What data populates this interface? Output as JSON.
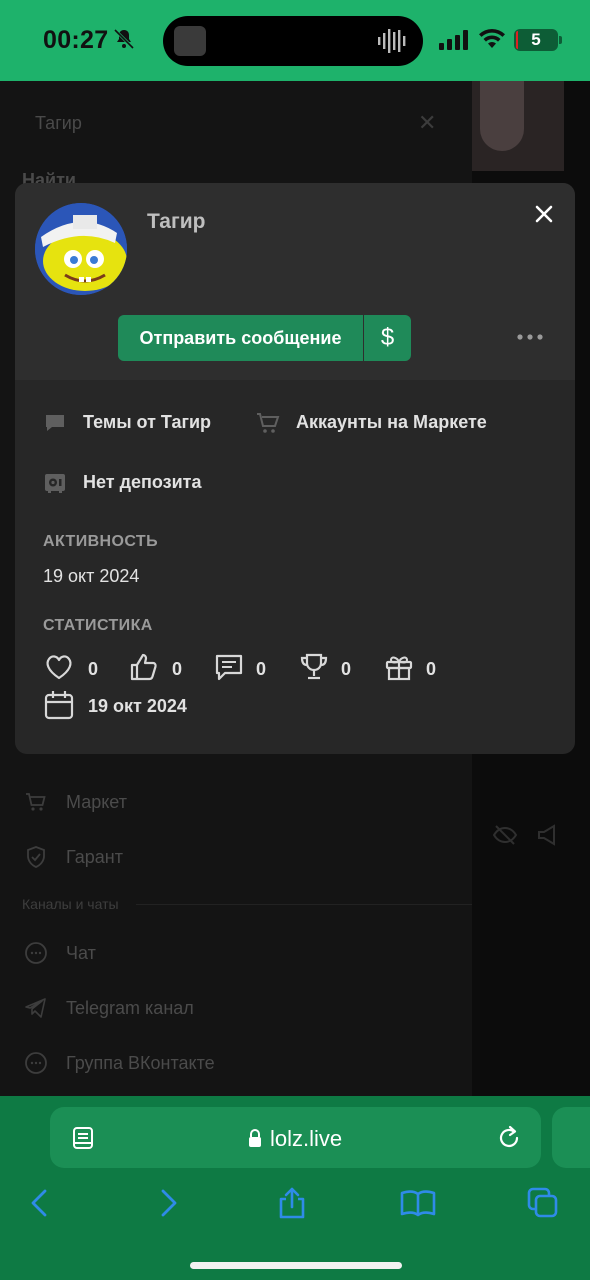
{
  "status_bar": {
    "time": "00:27",
    "battery": "5",
    "battery_level_percent": 5
  },
  "background_page": {
    "search_value": "Тагир",
    "find_label": "Найти",
    "items": [
      "Маркет",
      "Гарант"
    ],
    "section_label": "Каналы и чаты",
    "channels": [
      "Чат",
      "Telegram канал",
      "Группа ВКонтакте"
    ]
  },
  "profile_card": {
    "username": "Тагир",
    "send_message_label": "Отправить сообщение",
    "money_label": "$",
    "topics_label": "Темы от Тагир",
    "market_accounts_label": "Аккаунты на Маркете",
    "deposit_label": "Нет депозита",
    "activity_title": "АКТИВНОСТЬ",
    "activity_date": "19 окт 2024",
    "stats_title": "СТАТИСТИКА",
    "stats": {
      "likes": "0",
      "thumbs": "0",
      "messages": "0",
      "trophies": "0",
      "gifts": "0"
    },
    "registered_date": "19 окт 2024"
  },
  "browser": {
    "url": "lolz.live"
  },
  "colors": {
    "accent_green": "#1eb26b",
    "button_green": "#1f8a59",
    "browser_green": "#0e7a44",
    "card_bg": "#272727"
  }
}
